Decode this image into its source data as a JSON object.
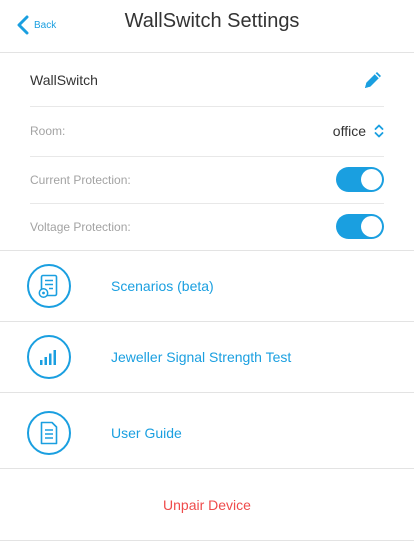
{
  "header": {
    "back_label": "Back",
    "title": "WallSwitch Settings"
  },
  "device": {
    "name": "WallSwitch"
  },
  "settings": {
    "room_label": "Room:",
    "room_value": "office",
    "current_protection_label": "Current Protection:",
    "current_protection_on": true,
    "voltage_protection_label": "Voltage Protection:",
    "voltage_protection_on": true
  },
  "actions": [
    {
      "label": "Scenarios (beta)",
      "icon": "scenarios-icon"
    },
    {
      "label": "Jeweller Signal Strength Test",
      "icon": "signal-strength-icon"
    },
    {
      "label": "User Guide",
      "icon": "document-icon"
    }
  ],
  "unpair_label": "Unpair Device",
  "colors": {
    "accent": "#1a9fe0",
    "danger": "#ef4b4b",
    "muted_text": "#a3a3a3"
  }
}
